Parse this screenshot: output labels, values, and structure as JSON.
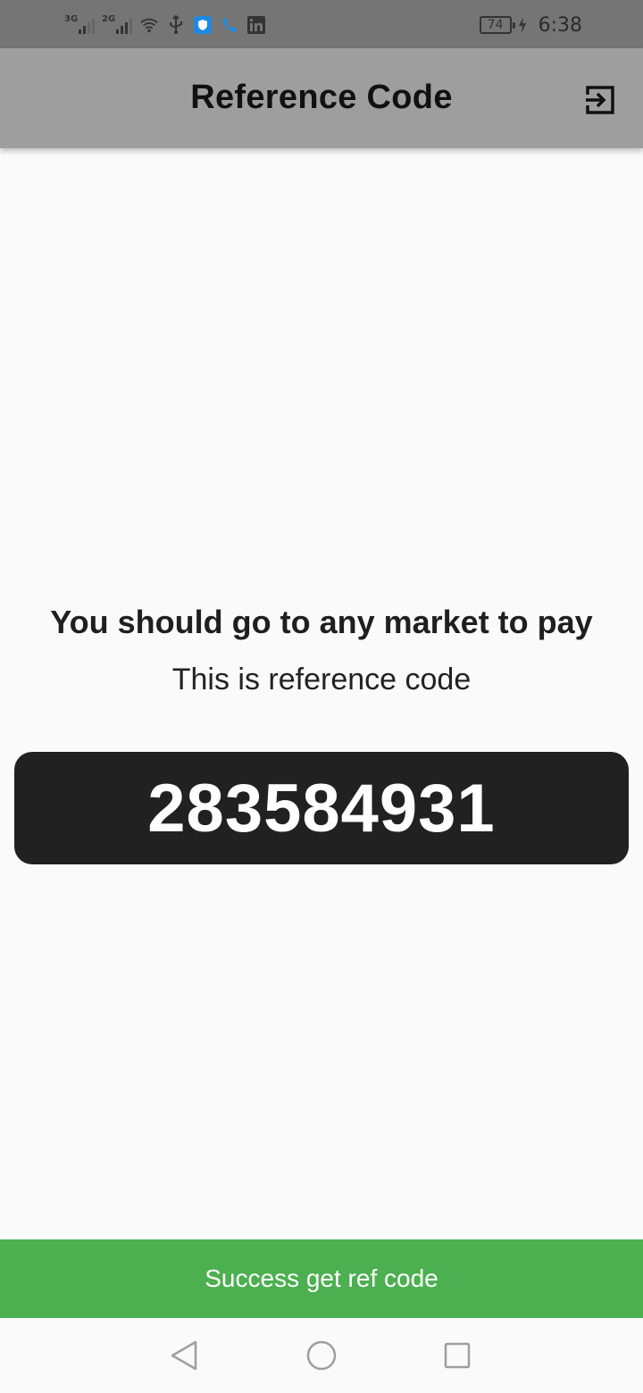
{
  "status_bar": {
    "network_1": "3G",
    "network_2": "2G",
    "battery_level": "74",
    "time": "6:38",
    "icons": [
      "signal-3g-icon",
      "signal-2g-icon",
      "wifi-icon",
      "usb-icon",
      "shield-app-icon",
      "phone-app-icon",
      "linkedin-icon",
      "battery-icon",
      "charging-icon"
    ]
  },
  "app_bar": {
    "title": "Reference Code",
    "action_icon": "exit-to-app-icon"
  },
  "content": {
    "headline": "You should go to any market to pay",
    "subline": "This is reference code",
    "reference_code": "283584931"
  },
  "snackbar": {
    "message": "Success get ref code",
    "color": "#4caf50"
  },
  "nav_bar": {
    "icons": [
      "back-icon",
      "home-icon",
      "recents-icon"
    ]
  },
  "colors": {
    "status_bar": "#757575",
    "app_bar": "#9e9e9e",
    "background": "#fafafa",
    "code_box": "#212121"
  }
}
